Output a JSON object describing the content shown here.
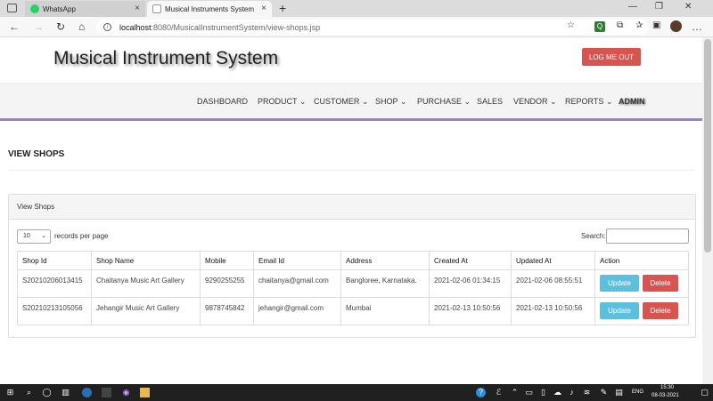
{
  "browser": {
    "tabs": [
      {
        "label": "WhatsApp",
        "active": false
      },
      {
        "label": "Musical Instruments System",
        "active": true
      }
    ],
    "url_host": "localhost",
    "url_rest": ":8080/MusicalInstrumentSystem/view-shops.jsp"
  },
  "header": {
    "title": "Musical Instrument System",
    "logout_label": "LOG ME OUT"
  },
  "nav": {
    "items": [
      {
        "label": "DASHBOARD"
      },
      {
        "label": "PRODUCT ⌄"
      },
      {
        "label": "CUSTOMER ⌄"
      },
      {
        "label": "SHOP ⌄"
      },
      {
        "label": "PURCHASE ⌄"
      },
      {
        "label": "SALES"
      },
      {
        "label": "VENDOR ⌄"
      },
      {
        "label": "REPORTS ⌄"
      },
      {
        "label": "ADMIN"
      }
    ]
  },
  "main": {
    "heading": "VIEW SHOPS",
    "panel_title": "View Shops",
    "length_value": "10",
    "length_label": "records per page",
    "search_label": "Search:",
    "columns": [
      "Shop Id",
      "Shop Name",
      "Mobile",
      "Email Id",
      "Address",
      "Created At",
      "Updated At",
      "Action"
    ],
    "rows": [
      {
        "shop_id": "S20210206013415",
        "shop_name": "Chaitanya Music Art Gallery",
        "mobile": "9290255255",
        "email": "chaitanya@gmail.com",
        "address": "Bangloree, Karnataka.",
        "created": "2021-02-06 01:34:15",
        "updated": "2021-02-06 08:55:51",
        "update_label": "Update",
        "delete_label": "Delete"
      },
      {
        "shop_id": "S20210213105056",
        "shop_name": "Jehangir Music Art Gallery",
        "mobile": "9878745842",
        "email": "jehangir@gmail.com",
        "address": "Mumbai",
        "created": "2021-02-13 10:50:56",
        "updated": "2021-02-13 10:50:56",
        "update_label": "Update",
        "delete_label": "Delete"
      }
    ]
  },
  "taskbar": {
    "lang": "ENG",
    "time": "15:30",
    "date": "08-03-2021"
  },
  "colors": {
    "accent_purple": "#9b7fd4",
    "danger": "#d9534f",
    "info": "#5bc0de"
  }
}
